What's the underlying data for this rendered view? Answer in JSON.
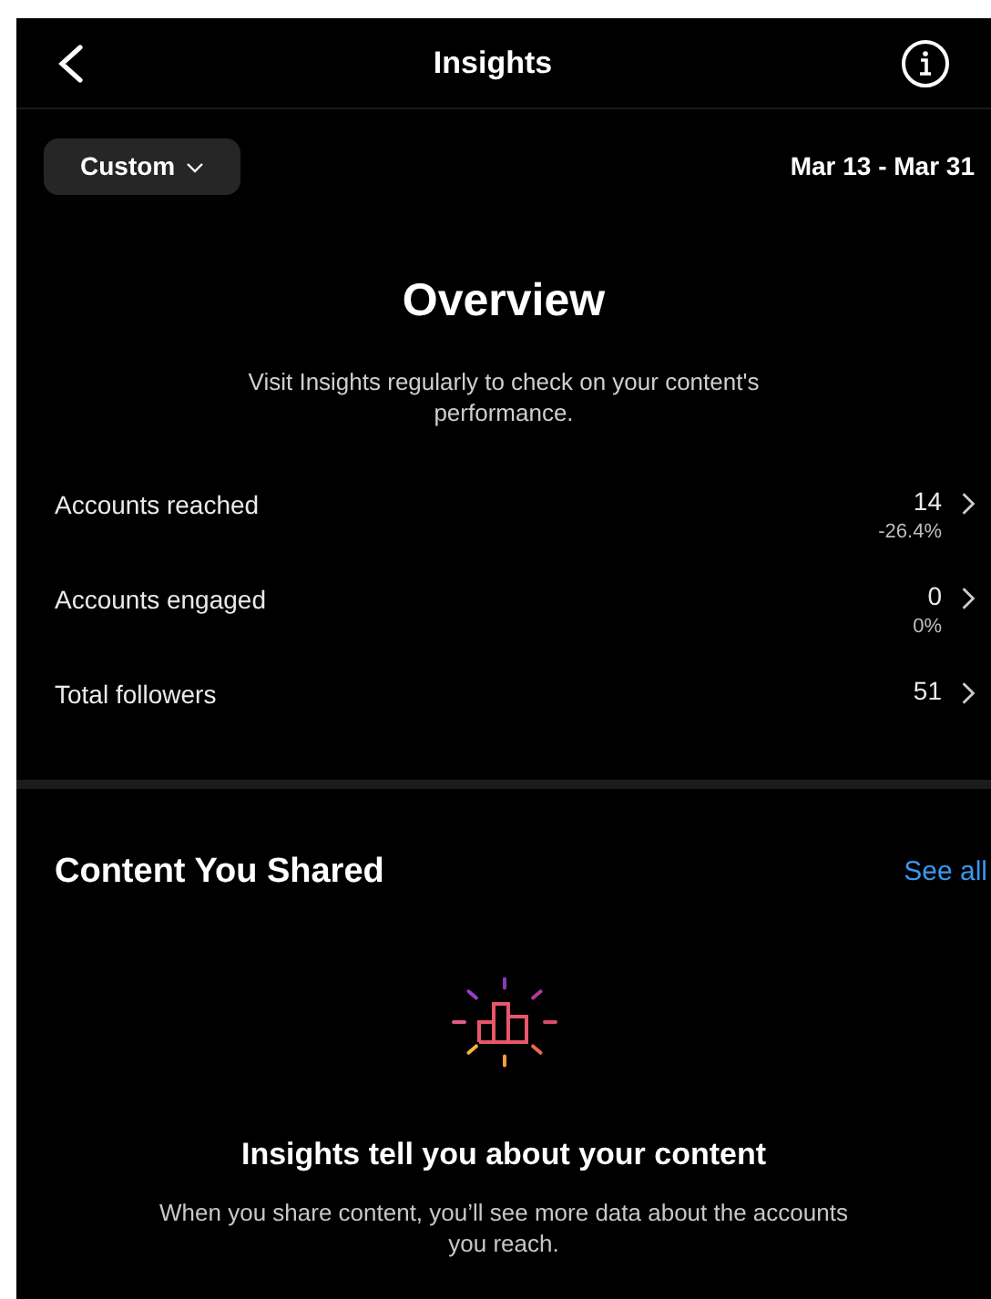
{
  "header": {
    "title": "Insights"
  },
  "filter": {
    "range_button": "Custom",
    "date_range": "Mar 13 - Mar 31"
  },
  "overview": {
    "title": "Overview",
    "description": "Visit Insights regularly to check on your content's performance.",
    "metrics": [
      {
        "label": "Accounts reached",
        "value": "14",
        "change": "-26.4%"
      },
      {
        "label": "Accounts engaged",
        "value": "0",
        "change": "0%"
      },
      {
        "label": "Total followers",
        "value": "51"
      }
    ]
  },
  "content_shared": {
    "title": "Content You Shared",
    "link": "See all",
    "empty_title": "Insights tell you about your content",
    "empty_text": "When you share content, you’ll see more data about the accounts you reach."
  }
}
